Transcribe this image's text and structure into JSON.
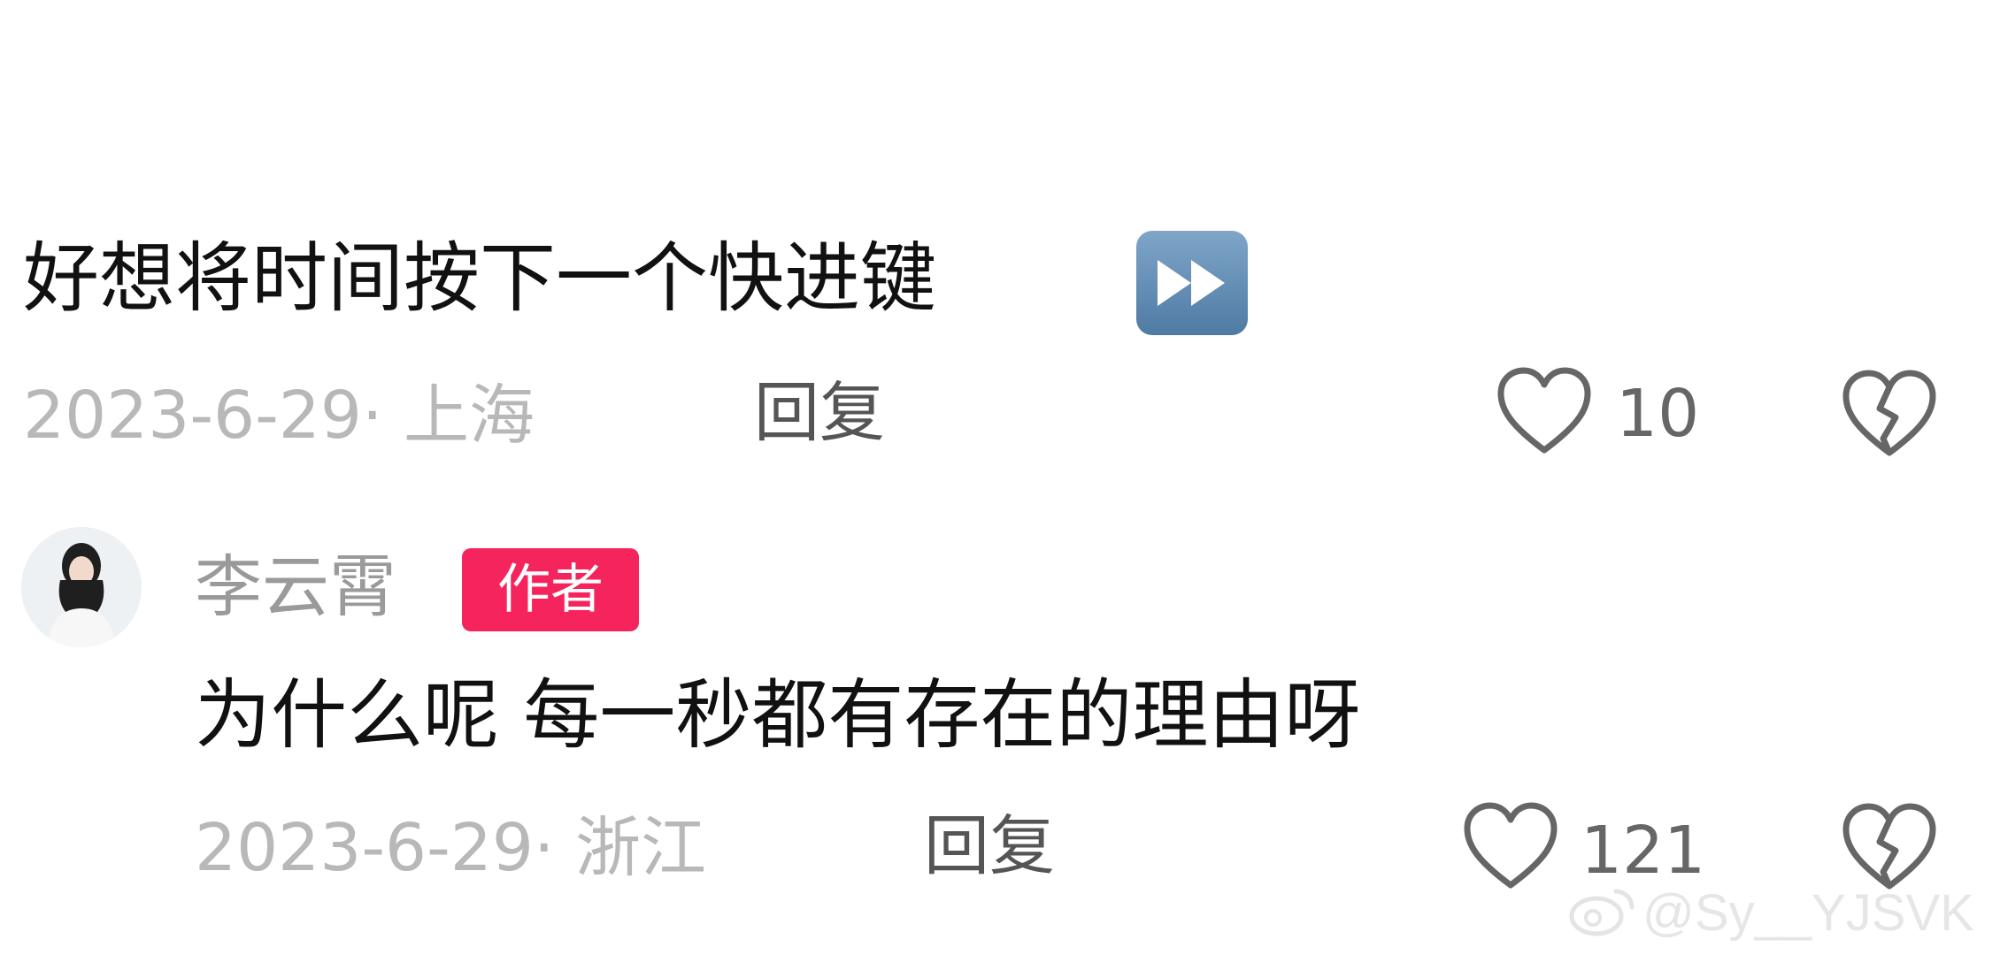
{
  "comment1": {
    "text": "好想将时间按下一个快进键",
    "emoji_icon": "fast-forward-icon",
    "date_location": "2023-6-29· 上海",
    "reply_label": "回复",
    "like_count": "10"
  },
  "comment2": {
    "username": "李云霄",
    "author_badge": "作者",
    "text": "为什么呢 每一秒都有存在的理由呀",
    "date_location": "2023-6-29· 浙江",
    "reply_label": "回复",
    "like_count": "121"
  },
  "watermark": {
    "text": "@Sy__YJSVK"
  },
  "colors": {
    "badge": "#f5245c",
    "meta_text": "#b8b8b8",
    "body_text": "#111111"
  }
}
